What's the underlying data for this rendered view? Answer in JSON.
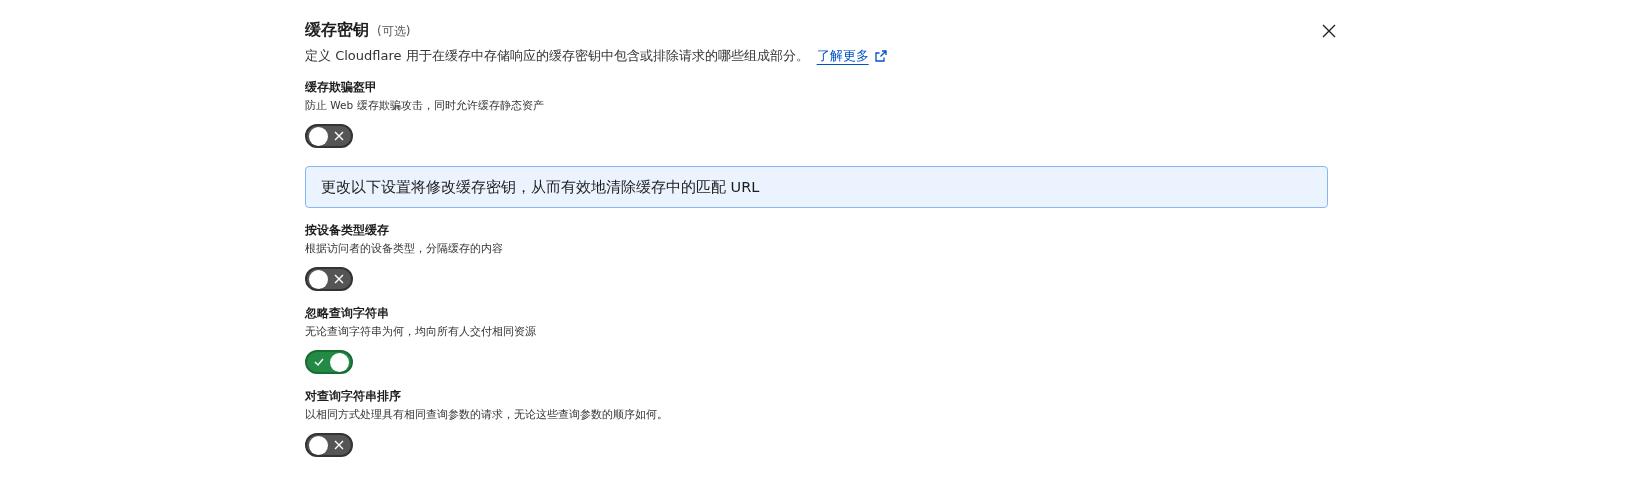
{
  "header": {
    "title": "缓存密钥",
    "optional": "(可选)",
    "description": "定义 Cloudflare 用于在缓存中存储响应的缓存密钥中包含或排除请求的哪些组成部分。",
    "link": "了解更多"
  },
  "items": [
    {
      "kind": "setting",
      "title": "缓存欺骗盔甲",
      "description": "防止 Web 缓存欺骗攻击，同时允许缓存静态资产",
      "on": false
    },
    {
      "kind": "notice",
      "text": "更改以下设置将修改缓存密钥，从而有效地清除缓存中的匹配 URL"
    },
    {
      "kind": "setting",
      "title": "按设备类型缓存",
      "description": "根据访问者的设备类型，分隔缓存的内容",
      "on": false
    },
    {
      "kind": "setting",
      "title": "忽略查询字符串",
      "description": "无论查询字符串为何，均向所有人交付相同资源",
      "on": true
    },
    {
      "kind": "setting",
      "title": "对查询字符串排序",
      "description": "以相同方式处理具有相同查询参数的请求，无论这些查询参数的顺序如何。",
      "on": false
    }
  ]
}
